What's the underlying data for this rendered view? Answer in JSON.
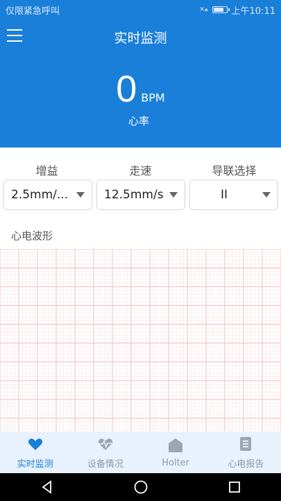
{
  "status_bar": {
    "carrier": "仅限紧急呼叫",
    "time": "上午10:11",
    "battery_level": 0.8
  },
  "header": {
    "title": "实时监测",
    "bpm_value": "0",
    "bpm_unit": "BPM",
    "heart_rate_label": "心率"
  },
  "controls": {
    "gain_label": "增益",
    "speed_label": "走速",
    "lead_label": "导联选择",
    "gain_value": "2.5mm/...",
    "speed_value": "12.5mm/s",
    "lead_value": "II"
  },
  "waveform": {
    "label": "心电波形"
  },
  "tabs": [
    {
      "label": "实时监测",
      "icon": "heart-icon",
      "active": true
    },
    {
      "label": "设备情况",
      "icon": "heart-pulse-icon",
      "active": false
    },
    {
      "label": "Holter",
      "icon": "home-icon",
      "active": false
    },
    {
      "label": "心电报告",
      "icon": "document-icon",
      "active": false
    }
  ],
  "colors": {
    "primary": "#1a7fd8",
    "grid_major": "#f2b8b8",
    "grid_minor": "#fbe3e3",
    "tab_inactive": "#8a9aa8"
  }
}
